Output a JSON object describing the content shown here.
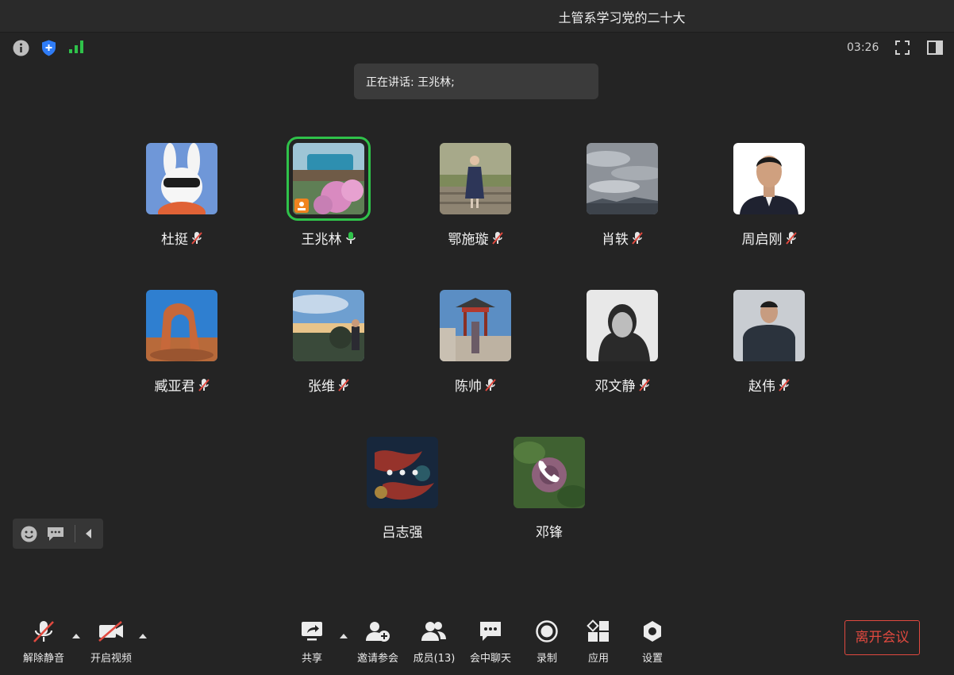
{
  "window": {
    "title": "土管系学习党的二十大"
  },
  "status": {
    "timer": "03:26"
  },
  "speaking": {
    "text": "正在讲话: 王兆林;"
  },
  "participants": [
    {
      "name": "杜挺",
      "mic": "muted",
      "avatar": "rabbit-avatar"
    },
    {
      "name": "王兆林",
      "mic": "speaking",
      "avatar": "train-flowers-avatar",
      "host": true
    },
    {
      "name": "鄂施璇",
      "mic": "muted",
      "avatar": "child-photo-avatar"
    },
    {
      "name": "肖轶",
      "mic": "muted",
      "avatar": "cloudy-sky-avatar"
    },
    {
      "name": "周启刚",
      "mic": "muted",
      "avatar": "portrait-avatar"
    },
    {
      "name": "臧亚君",
      "mic": "muted",
      "avatar": "arch-rock-avatar"
    },
    {
      "name": "张维",
      "mic": "muted",
      "avatar": "sunset-photographer-avatar"
    },
    {
      "name": "陈帅",
      "mic": "muted",
      "avatar": "pavilion-avatar"
    },
    {
      "name": "邓文静",
      "mic": "muted",
      "avatar": "bw-portrait-avatar"
    },
    {
      "name": "赵伟",
      "mic": "muted",
      "avatar": "man-portrait-avatar"
    },
    {
      "name": "吕志强",
      "mic": "connecting",
      "avatar": "koi-art-avatar"
    },
    {
      "name": "邓锋",
      "mic": "phone",
      "avatar": "flower-avatar"
    }
  ],
  "toolbar": {
    "unmute": "解除静音",
    "start_video": "开启视频",
    "share": "共享",
    "invite": "邀请参会",
    "members": "成员(13)",
    "chat": "会中聊天",
    "record": "录制",
    "apps": "应用",
    "settings": "设置",
    "leave": "离开会议"
  },
  "colors": {
    "accent_green": "#2fc24a",
    "leave_red": "#e0493f",
    "shield_blue": "#2f7cf6"
  }
}
